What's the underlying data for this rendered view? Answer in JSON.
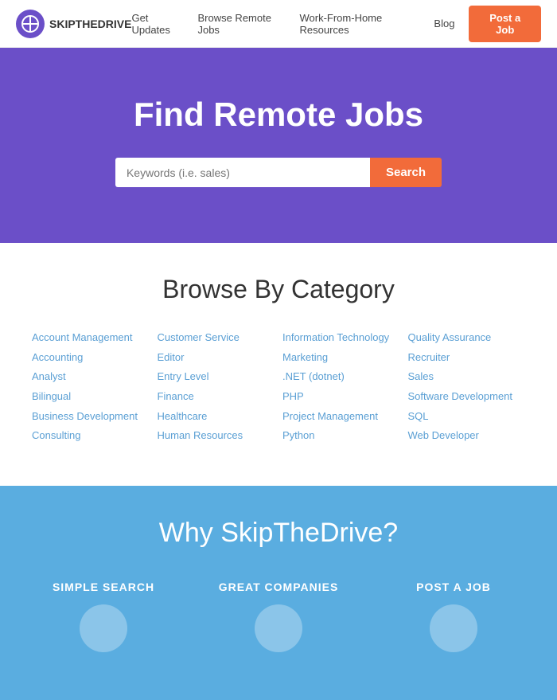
{
  "header": {
    "logo_text": "SKIPTHEDRIVE",
    "nav": {
      "get_updates": "Get Updates",
      "browse_remote_jobs": "Browse Remote Jobs",
      "work_from_home": "Work-From-Home Resources",
      "blog": "Blog",
      "post_a_job": "Post a Job"
    }
  },
  "hero": {
    "title": "Find Remote Jobs",
    "search_placeholder": "Keywords (i.e. sales)",
    "search_button": "Search"
  },
  "browse": {
    "title": "Browse By Category",
    "col1": [
      "Account Management",
      "Accounting",
      "Analyst",
      "Bilingual",
      "Business Development",
      "Consulting"
    ],
    "col2": [
      "Customer Service",
      "Editor",
      "Entry Level",
      "Finance",
      "Healthcare",
      "Human Resources"
    ],
    "col3": [
      "Information Technology",
      "Marketing",
      ".NET (dotnet)",
      "PHP",
      "Project Management",
      "Python"
    ],
    "col4": [
      "Quality Assurance",
      "Recruiter",
      "Sales",
      "Software Development",
      "SQL",
      "Web Developer"
    ]
  },
  "why": {
    "title": "Why SkipTheDrive?",
    "items": [
      {
        "label": "SIMPLE SEARCH"
      },
      {
        "label": "GREAT COMPANIES"
      },
      {
        "label": "POST A JOB"
      }
    ]
  }
}
